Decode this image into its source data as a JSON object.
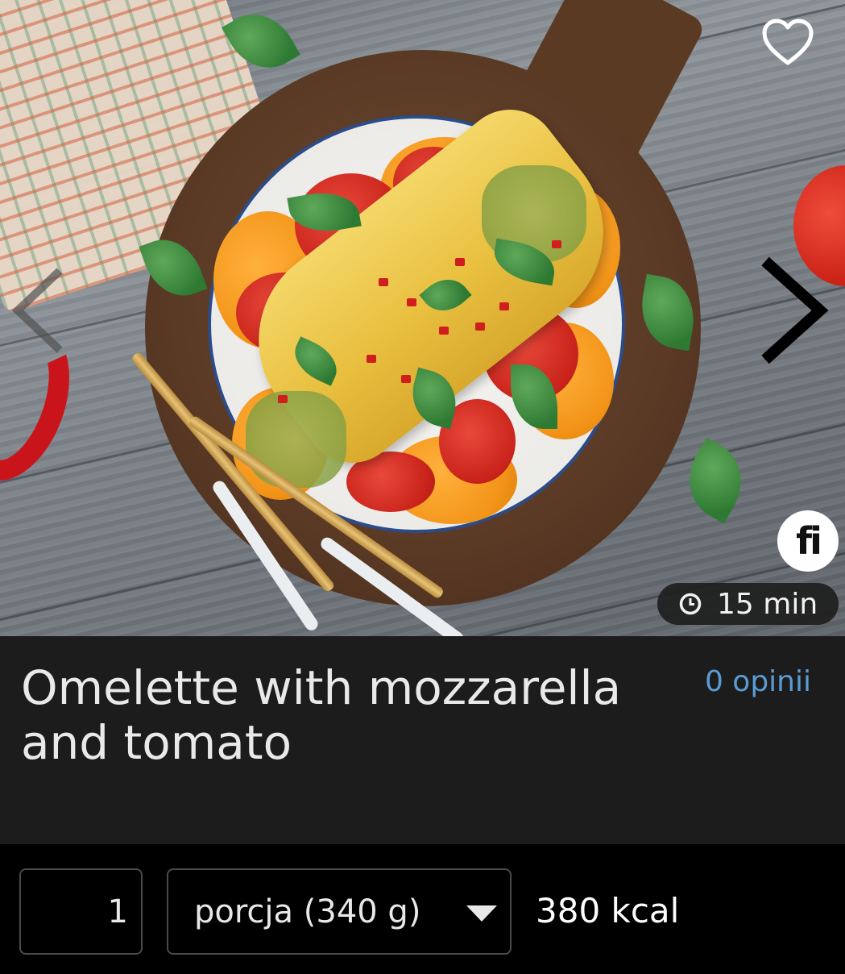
{
  "hero": {
    "image_alt": "Omelette with mozzarella and tomato on a wooden board",
    "favorite_icon": "heart-outline-icon",
    "prev_icon": "chevron-left-icon",
    "next_icon": "chevron-right-icon",
    "brand_logo_text": "fi",
    "prep_time": "15 min",
    "clock_icon": "clock-icon"
  },
  "recipe": {
    "title": "Omelette with mozzarella and tomato",
    "reviews_link": "0 opinii"
  },
  "portion": {
    "quantity": "1",
    "unit_selected": "porcja (340 g)",
    "kcal": "380 kcal"
  },
  "colors": {
    "title_bg": "#1c1c1c",
    "controls_bg": "#000000",
    "link": "#5b9bd5",
    "text": "#e9e9e9"
  }
}
